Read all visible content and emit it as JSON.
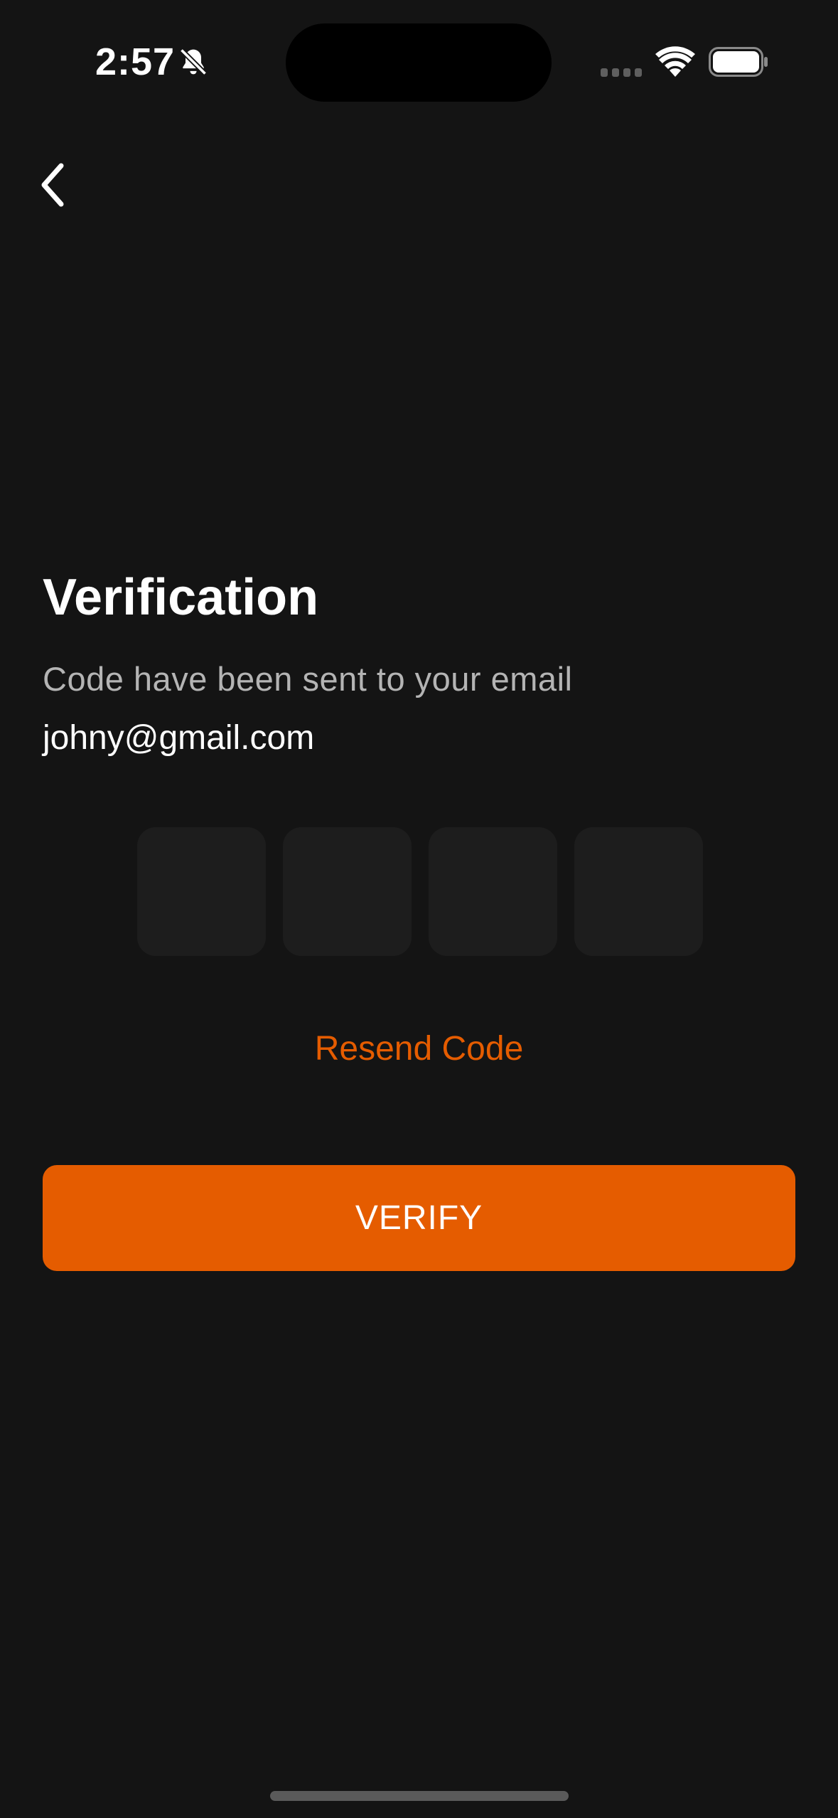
{
  "status_bar": {
    "time": "2:57",
    "icons": [
      "bell-slash-icon",
      "signal-icon",
      "wifi-icon",
      "battery-icon"
    ]
  },
  "nav": {
    "back_icon": "chevron-left-icon"
  },
  "content": {
    "title": "Verification",
    "subtitle": "Code have been sent to your email",
    "email": "johny@gmail.com"
  },
  "otp": {
    "digits": [
      "",
      "",
      "",
      ""
    ]
  },
  "actions": {
    "resend_label": "Resend Code",
    "verify_label": "VERIFY"
  },
  "colors": {
    "background": "#141414",
    "accent": "#e55c00",
    "otp_box": "#1d1d1d",
    "subtitle": "#b4b4b4"
  }
}
